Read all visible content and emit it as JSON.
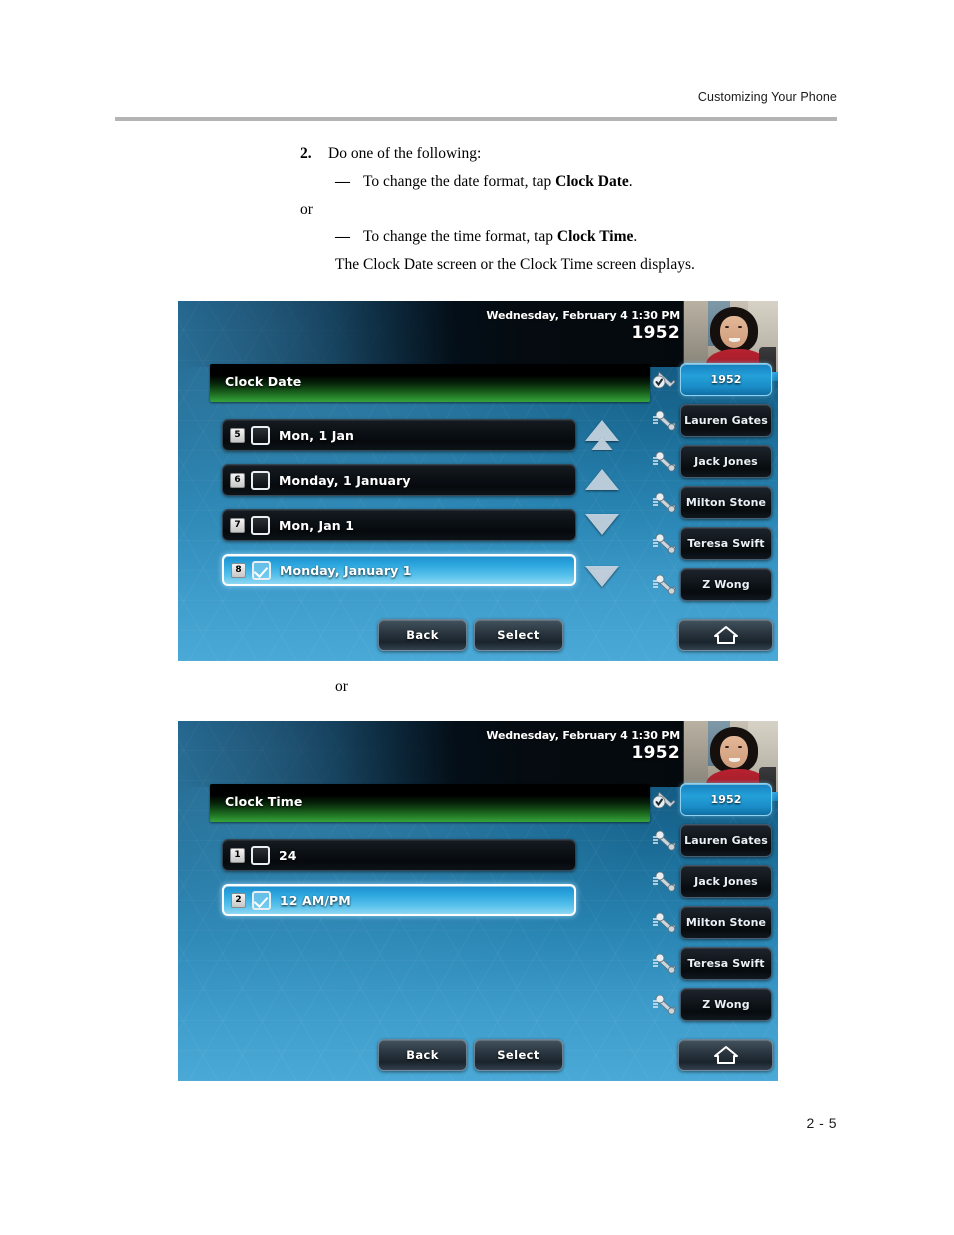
{
  "document": {
    "header_title": "Customizing Your Phone",
    "page_number": "2 - 5"
  },
  "instructions": {
    "step_number": "2.",
    "step_text": "Do one of the following:",
    "dash": "—",
    "bullet_1_prefix": "To change the date format, tap ",
    "bullet_1_bold": "Clock Date",
    "bullet_1_suffix": ".",
    "or_label": "or",
    "bullet_2_prefix": "To change the time format, tap ",
    "bullet_2_bold": "Clock Time",
    "bullet_2_suffix": ".",
    "closing_text": "The Clock Date screen or the Clock Time screen displays."
  },
  "between_screens_or": "or",
  "screens": [
    {
      "id": "clock-date",
      "status": {
        "datetime": "Wednesday, February 4  1:30 PM",
        "extension": "1952"
      },
      "title": "Clock Date",
      "list": [
        {
          "index": "5",
          "label": "Mon, 1 Jan",
          "checked": false,
          "selected": false
        },
        {
          "index": "6",
          "label": "Monday, 1 January",
          "checked": false,
          "selected": false
        },
        {
          "index": "7",
          "label": "Mon, Jan 1",
          "checked": false,
          "selected": false
        },
        {
          "index": "8",
          "label": "Monday, January 1",
          "checked": true,
          "selected": true
        }
      ],
      "arrows": [
        "page-up-icon",
        "scroll-up-icon",
        "scroll-down-icon",
        "page-down-icon"
      ],
      "line_keys": [
        {
          "label": "1952",
          "active": true,
          "icon": "handset-check-icon"
        },
        {
          "label": "Lauren Gates",
          "active": false,
          "icon": "handset-icon"
        },
        {
          "label": "Jack Jones",
          "active": false,
          "icon": "handset-icon"
        },
        {
          "label": "Milton Stone",
          "active": false,
          "icon": "handset-icon"
        },
        {
          "label": "Teresa Swift",
          "active": false,
          "icon": "handset-icon"
        },
        {
          "label": "Z Wong",
          "active": false,
          "icon": "handset-icon"
        }
      ],
      "soft_keys": {
        "back": "Back",
        "select": "Select",
        "home_icon": "home-icon"
      }
    },
    {
      "id": "clock-time",
      "status": {
        "datetime": "Wednesday, February 4  1:30 PM",
        "extension": "1952"
      },
      "title": "Clock Time",
      "list": [
        {
          "index": "1",
          "label": "24",
          "checked": false,
          "selected": false
        },
        {
          "index": "2",
          "label": "12 AM/PM",
          "checked": true,
          "selected": true
        }
      ],
      "line_keys": [
        {
          "label": "1952",
          "active": true,
          "icon": "handset-check-icon"
        },
        {
          "label": "Lauren Gates",
          "active": false,
          "icon": "handset-icon"
        },
        {
          "label": "Jack Jones",
          "active": false,
          "icon": "handset-icon"
        },
        {
          "label": "Milton Stone",
          "active": false,
          "icon": "handset-icon"
        },
        {
          "label": "Teresa Swift",
          "active": false,
          "icon": "handset-icon"
        },
        {
          "label": "Z Wong",
          "active": false,
          "icon": "handset-icon"
        }
      ],
      "soft_keys": {
        "back": "Back",
        "select": "Select",
        "home_icon": "home-icon"
      }
    }
  ],
  "colors": {
    "title_bar_green": "#36a53a",
    "selection_blue": "#30a9e0",
    "screen_blue": "#2a86b4",
    "rule_gray": "#b4b4b4"
  }
}
